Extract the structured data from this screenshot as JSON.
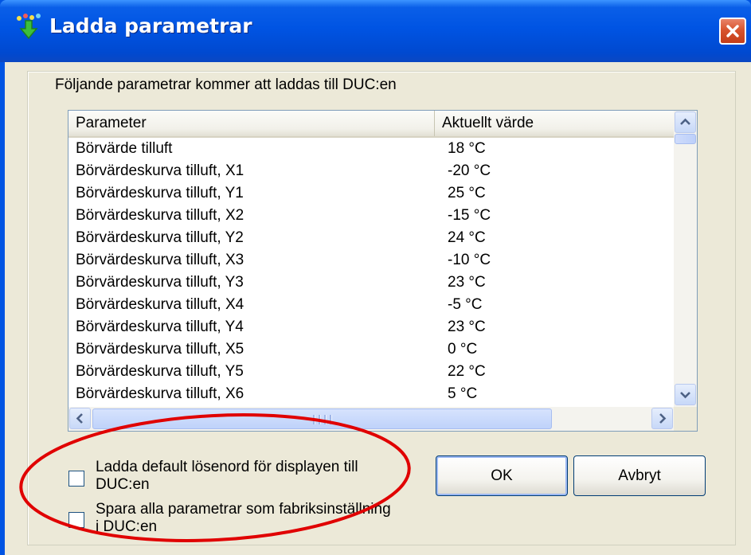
{
  "window": {
    "title": "Ladda parametrar",
    "icon": "download-arrow-icon"
  },
  "dialog": {
    "caption": "Följande parametrar kommer att laddas till DUC:en"
  },
  "list": {
    "columns": [
      "Parameter",
      "Aktuellt värde"
    ],
    "rows": [
      {
        "parameter": "Börvärde tilluft",
        "value": "18 °C"
      },
      {
        "parameter": "Börvärdeskurva tilluft, X1",
        "value": "-20 °C"
      },
      {
        "parameter": "Börvärdeskurva tilluft, Y1",
        "value": "25 °C"
      },
      {
        "parameter": "Börvärdeskurva tilluft, X2",
        "value": "-15 °C"
      },
      {
        "parameter": "Börvärdeskurva tilluft, Y2",
        "value": "24 °C"
      },
      {
        "parameter": "Börvärdeskurva tilluft, X3",
        "value": "-10 °C"
      },
      {
        "parameter": "Börvärdeskurva tilluft, Y3",
        "value": "23 °C"
      },
      {
        "parameter": "Börvärdeskurva tilluft, X4",
        "value": "-5 °C"
      },
      {
        "parameter": "Börvärdeskurva tilluft, Y4",
        "value": "23 °C"
      },
      {
        "parameter": "Börvärdeskurva tilluft, X5",
        "value": "0 °C"
      },
      {
        "parameter": "Börvärdeskurva tilluft, Y5",
        "value": "22 °C"
      },
      {
        "parameter": "Börvärdeskurva tilluft, X6",
        "value": "5 °C"
      }
    ]
  },
  "options": {
    "load_password": {
      "line1": "Ladda default lösenord för displayen till",
      "line2": "DUC:en",
      "checked": false
    },
    "save_factory": {
      "line1": "Spara alla parametrar som fabriksinställning",
      "line2": "i DUC:en",
      "checked": false
    }
  },
  "buttons": {
    "ok": "OK",
    "cancel": "Avbryt"
  },
  "annotation": {
    "color": "#e00000"
  }
}
